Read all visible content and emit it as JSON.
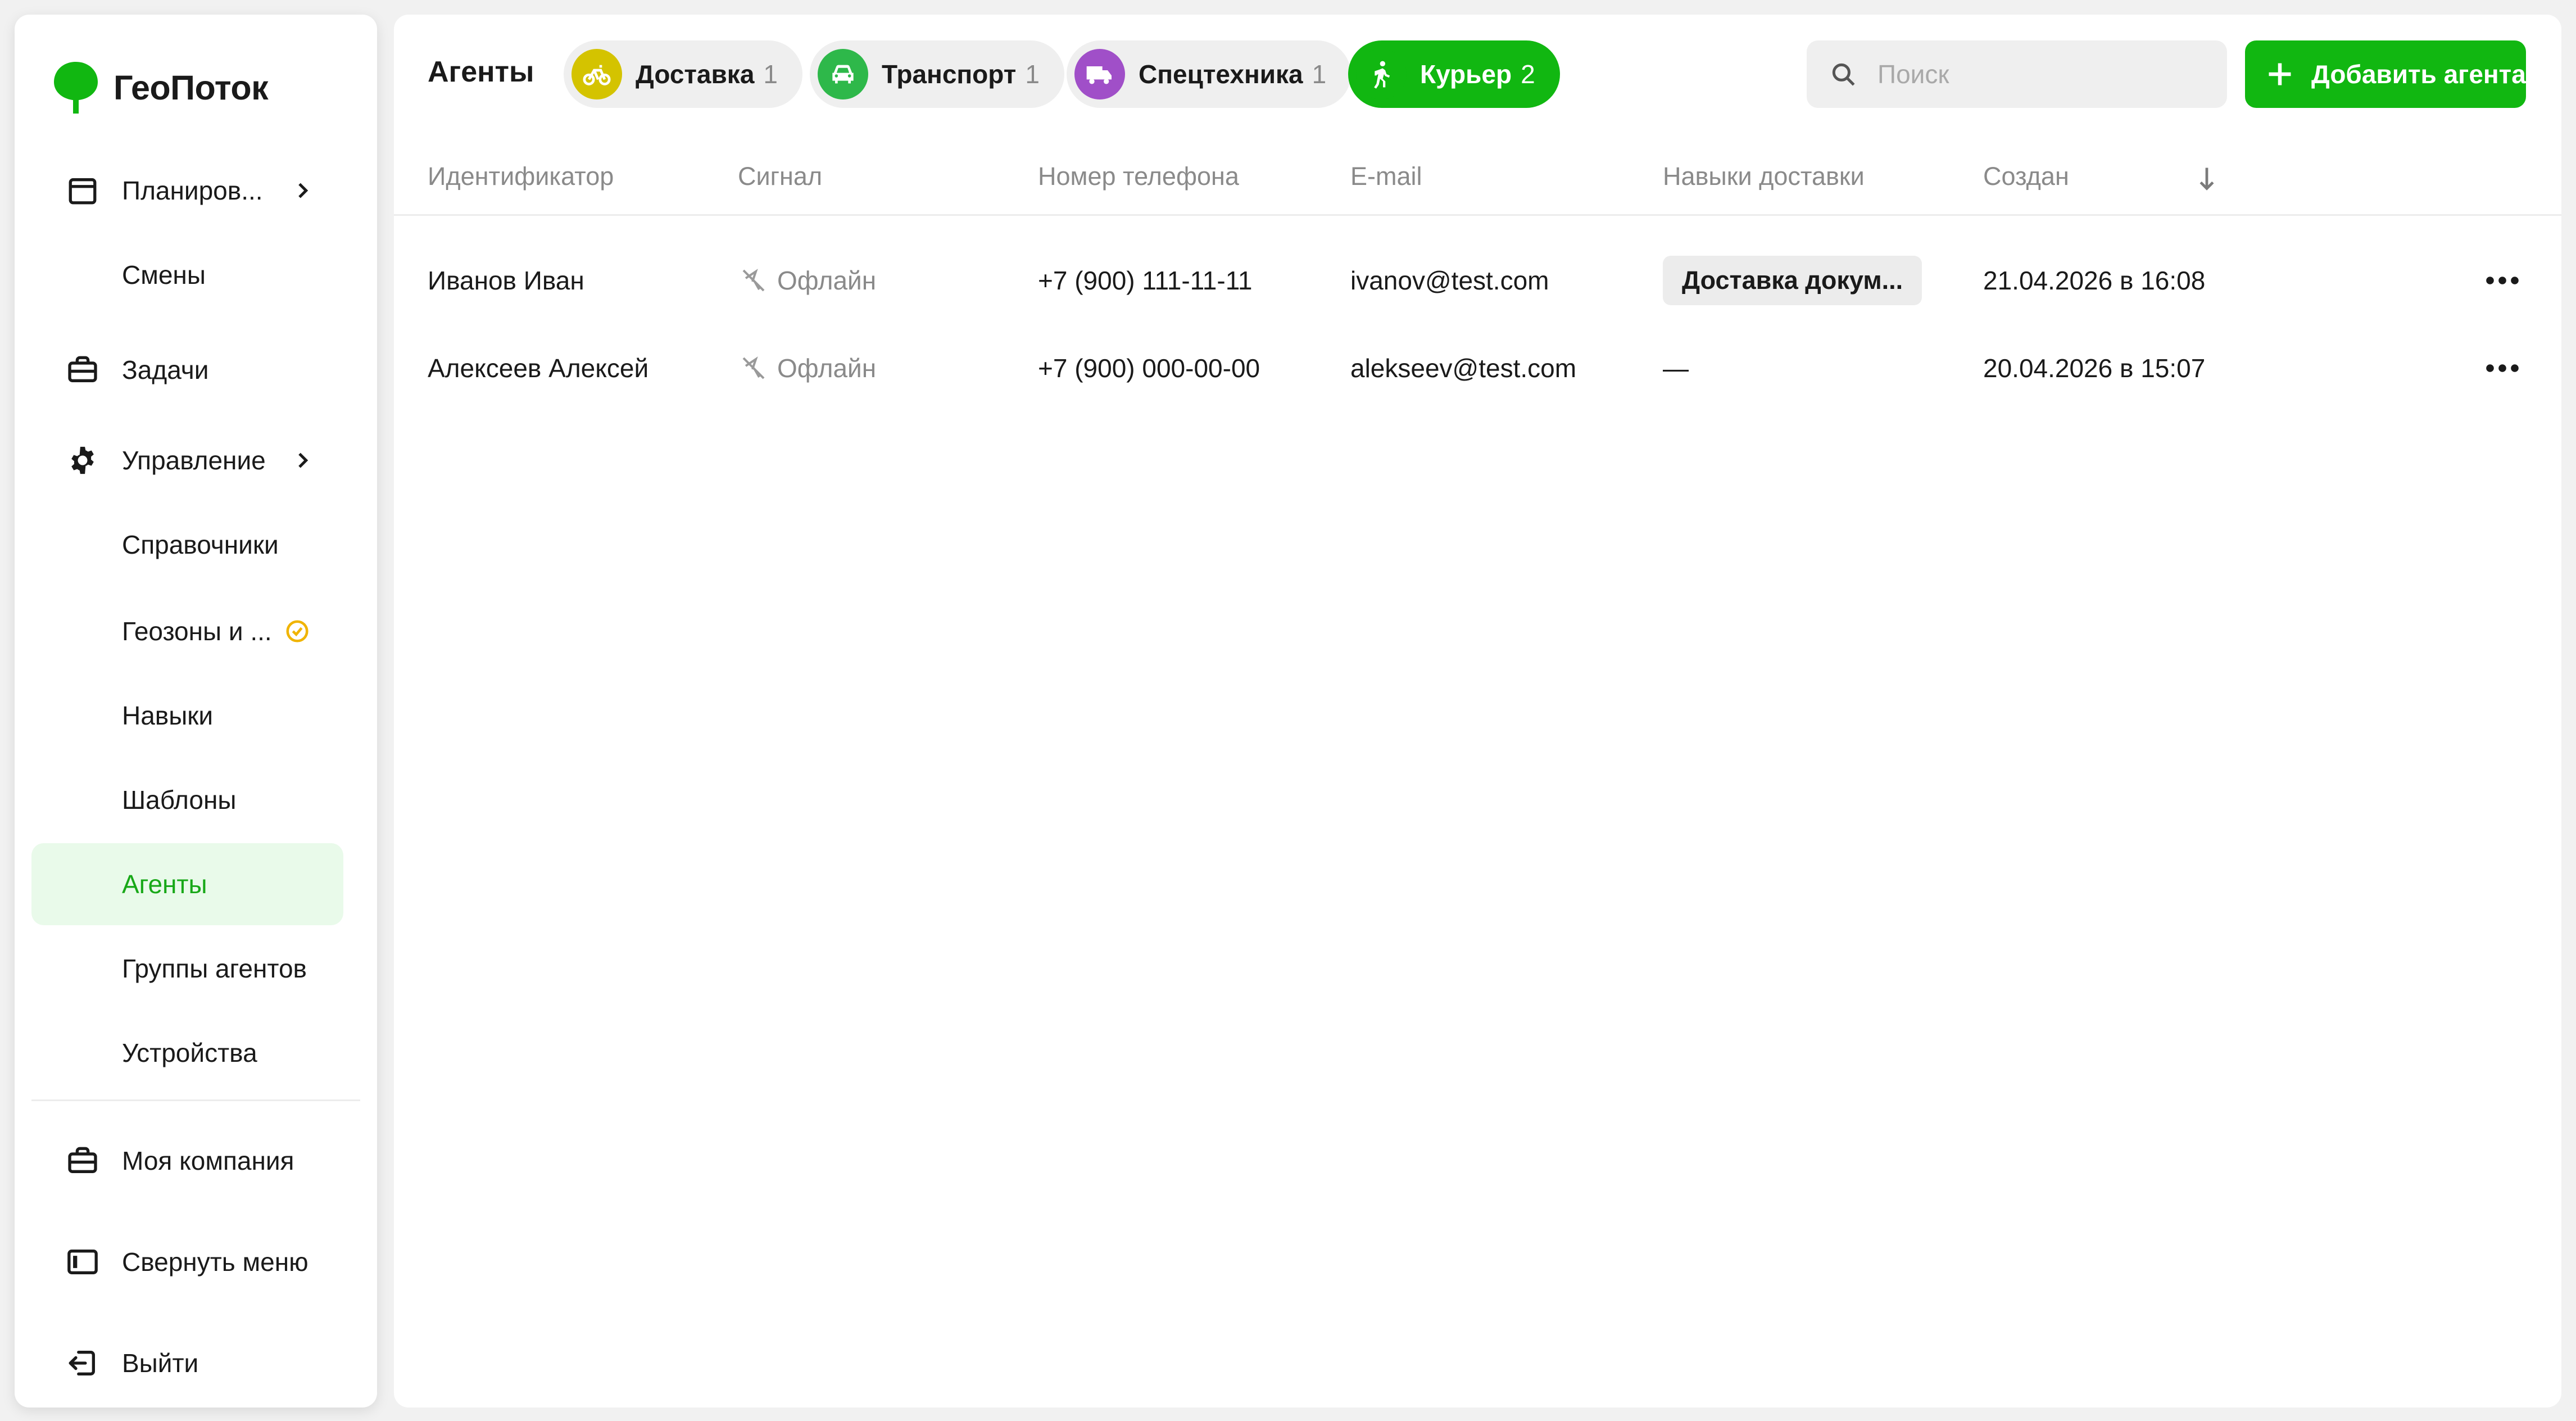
{
  "app": {
    "name": "ГеоПоток",
    "brand_color": "#11b711"
  },
  "sidebar": {
    "items": [
      {
        "label": "Планиров...",
        "icon": "calendar-icon",
        "has_chevron": true
      },
      {
        "label": "Смены"
      },
      {
        "label": "Задачи",
        "icon": "briefcase-icon"
      },
      {
        "label": "Управление",
        "icon": "gear-icon",
        "has_chevron": true
      },
      {
        "label": "Справочники"
      },
      {
        "label": "Геозоны и ...",
        "badge_icon": "clock-icon"
      },
      {
        "label": "Навыки"
      },
      {
        "label": "Шаблоны"
      },
      {
        "label": "Агенты",
        "active": true
      },
      {
        "label": "Группы агентов"
      },
      {
        "label": "Устройства"
      }
    ],
    "bottom": [
      {
        "label": "Моя компания",
        "icon": "briefcase-icon"
      },
      {
        "label": "Свернуть меню",
        "icon": "collapse-sidebar-icon"
      },
      {
        "label": "Выйти",
        "icon": "logout-icon"
      }
    ]
  },
  "header": {
    "title": "Агенты",
    "chips": [
      {
        "label": "Доставка",
        "count": "1",
        "icon": "bicycle-icon",
        "icon_color": "#d4c300"
      },
      {
        "label": "Транспорт",
        "count": "1",
        "icon": "car-icon",
        "icon_color": "#2eb84a"
      },
      {
        "label": "Спецтехника",
        "count": "1",
        "icon": "truck-icon",
        "icon_color": "#a04fc8"
      },
      {
        "label": "Курьер",
        "count": "2",
        "icon": "walking-icon",
        "icon_color": "#11b711",
        "active": true
      }
    ],
    "search": {
      "placeholder": "Поиск",
      "value": ""
    },
    "add_button": "Добавить агента"
  },
  "table": {
    "columns": [
      "Идентификатор",
      "Сигнал",
      "Номер телефона",
      "E-mail",
      "Навыки доставки",
      "Создан"
    ],
    "rows": [
      {
        "id": "Иванов Иван",
        "signal": "Офлайн",
        "phone": "+7 (900) 111-11-11",
        "email": "ivanov@test.com",
        "skills": "Доставка докум...",
        "created": "21.04.2026 в 16:08"
      },
      {
        "id": "Алексеев Алексей",
        "signal": "Офлайн",
        "phone": "+7 (900) 000-00-00",
        "email": "alekseev@test.com",
        "skills": "—",
        "created": "20.04.2026 в 15:07"
      }
    ]
  }
}
